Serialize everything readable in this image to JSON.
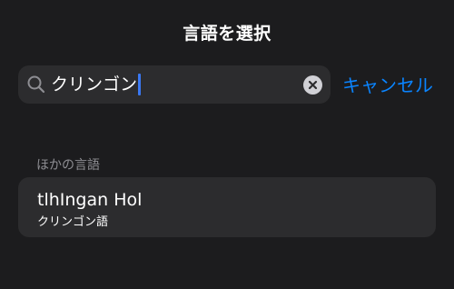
{
  "header": {
    "title": "言語を選択"
  },
  "search": {
    "query": "クリンゴン",
    "icon": "search-icon",
    "clear_icon": "clear-icon"
  },
  "toolbar": {
    "cancel_label": "キャンセル"
  },
  "section": {
    "header": "ほかの言語"
  },
  "results": [
    {
      "name": "tlhIngan Hol",
      "localized_name": "クリンゴン語"
    }
  ],
  "colors": {
    "background": "#1c1c1e",
    "field": "#2c2c2e",
    "accent": "#0a84ff",
    "caret": "#3a78f2",
    "secondary_text": "#8e8e93"
  }
}
